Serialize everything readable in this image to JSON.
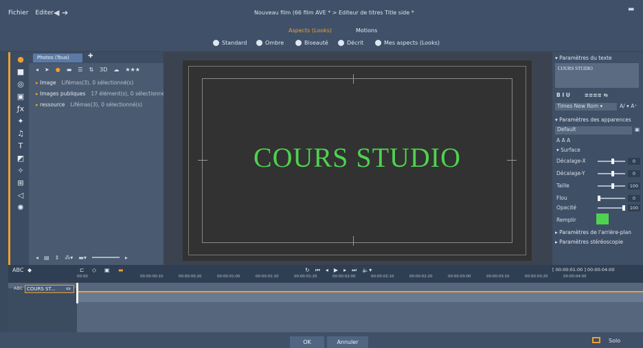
{
  "topbar": {
    "menu": [
      "Fichier",
      "Editer"
    ],
    "breadcrumb": "Nouveau film (66 film AVE * > Editeur de titres Title side *",
    "minimize_icon": "minimize-icon"
  },
  "modes": {
    "looks": "Aspects (Looks)",
    "motions": "Motions",
    "styles": [
      "Standard",
      "Ombre",
      "Biseauté",
      "Décrit",
      "Mes aspects (Looks)"
    ]
  },
  "library": {
    "tab": "Photos (Tous)",
    "items": [
      {
        "label": "Image",
        "sub": "Lifémas(3), 0 sélectionné(s)"
      },
      {
        "label": "Images publiques",
        "sub": "17 élément(s), 0 sélectionné(s)"
      },
      {
        "label": "ressource",
        "sub": "Lifémas(3), 0 sélectionné(s)"
      }
    ]
  },
  "preview": {
    "title_text": "COURS STUDIO",
    "text_color": "#4fd24f"
  },
  "right_panel": {
    "text_params_header": "Paramètres du texte",
    "text_content": "COURS STUDIO",
    "font_name": "Times New Rom",
    "font_size": "A/",
    "appearance_header": "Paramètres des apparences",
    "preset": "Default",
    "surface_label": "Surface",
    "rows": [
      {
        "label": "Décalage-X",
        "value": "0"
      },
      {
        "label": "Décalage-Y",
        "value": "0"
      },
      {
        "label": "Taille",
        "value": "100"
      },
      {
        "label": "Flou",
        "value": "0"
      },
      {
        "label": "Opacité",
        "value": "100"
      }
    ],
    "fill_label": "Remplir",
    "foreground_header": "Paramètres de l'arrière-plan",
    "stereo_header": "Paramètres stéréoscopie"
  },
  "timeline": {
    "ruler": [
      "00:00",
      "00:00:00:10",
      "00:00:00:20",
      "00:00:01:00",
      "00:00:01:10",
      "00:00:01:20",
      "00:00:02:00",
      "00:00:02:10",
      "00:00:02:20",
      "00:00:03:00",
      "00:00:03:10",
      "00:00:03:20",
      "00:00:04:00"
    ],
    "right_label": "[ 00:00:01:00 ]  00:00:04:00",
    "track_name": "COURS ST..."
  },
  "footer": {
    "ok": "OK",
    "cancel": "Annuler",
    "solo": "Solo"
  }
}
